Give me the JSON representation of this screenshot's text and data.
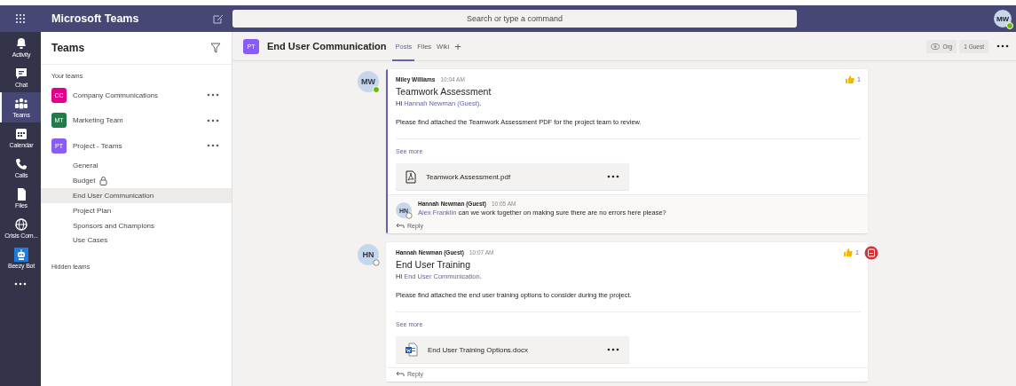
{
  "app_bar": {
    "title": "Microsoft Teams",
    "search_placeholder": "Search or type a command",
    "user_initials": "MW",
    "user_available": true
  },
  "rail": [
    {
      "label": "Activity",
      "selected": false
    },
    {
      "label": "Chat",
      "selected": false
    },
    {
      "label": "Teams",
      "selected": true
    },
    {
      "label": "Calendar",
      "selected": false
    },
    {
      "label": "Calls",
      "selected": false
    },
    {
      "label": "Files",
      "selected": false
    },
    {
      "label": "Crisis Com...",
      "selected": false
    },
    {
      "label": "Beezy Bot",
      "selected": false
    }
  ],
  "sidebar": {
    "title": "Teams",
    "section": "Your teams",
    "hidden_label": "Hidden teams",
    "teams": [
      {
        "initials": "CC",
        "name": "Company Communications",
        "color": "#e3008c"
      },
      {
        "initials": "MT",
        "name": "Marketing Team",
        "color": "#237b4b"
      },
      {
        "initials": "PT",
        "name": "Project - Teams",
        "color": "#8a5cf6",
        "channels": [
          {
            "name": "General",
            "locked": false,
            "selected": false
          },
          {
            "name": "Budget",
            "locked": true,
            "selected": false
          },
          {
            "name": "End User Communication",
            "locked": false,
            "selected": true
          },
          {
            "name": "Project Plan",
            "locked": false,
            "selected": false
          },
          {
            "name": "Sponsors and Champions",
            "locked": false,
            "selected": false
          },
          {
            "name": "Use Cases",
            "locked": false,
            "selected": false
          }
        ]
      }
    ]
  },
  "channel_header": {
    "team_initials": "PT",
    "title": "End User Communication",
    "tabs": [
      {
        "label": "Posts",
        "selected": true
      },
      {
        "label": "Files",
        "selected": false
      },
      {
        "label": "Wiki",
        "selected": false
      }
    ],
    "add_tab": "+",
    "org_label": "Org",
    "guest_label": "1 Guest"
  },
  "posts": [
    {
      "initials": "MW",
      "available": true,
      "author": "Miley Williams",
      "time": "10:04 AM",
      "subject": "Teamwork Assessment",
      "greeting": "Hi",
      "mention": "Hannah Newman (Guest)",
      "greeting_end": ".",
      "body": "Please find attached the Teamwork Assessment PDF for the project team to review.",
      "see_more": "See more",
      "attachment": {
        "name": "Teamwork Assessment.pdf",
        "kind": "pdf"
      },
      "likes": "1",
      "important": false,
      "highlighted": true,
      "replies": [
        {
          "initials": "HN",
          "available": false,
          "author": "Hannah Newman (Guest)",
          "time": "10:05 AM",
          "mention": "Alex Franklin",
          "text": "can we work together on making sure there are no errors here please?"
        }
      ],
      "reply_label": "Reply"
    },
    {
      "initials": "HN",
      "available": false,
      "author": "Hannah Newman (Guest)",
      "time": "10:07 AM",
      "subject": "End User Training",
      "greeting": "Hi",
      "mention": "End User Communication",
      "greeting_end": ".",
      "body": "Please find attached the end user training options to consider during the project.",
      "see_more": "See more",
      "attachment": {
        "name": "End User Training Options.docx",
        "kind": "word"
      },
      "likes": "1",
      "important": true,
      "highlighted": false,
      "reply_label": "Reply"
    }
  ]
}
